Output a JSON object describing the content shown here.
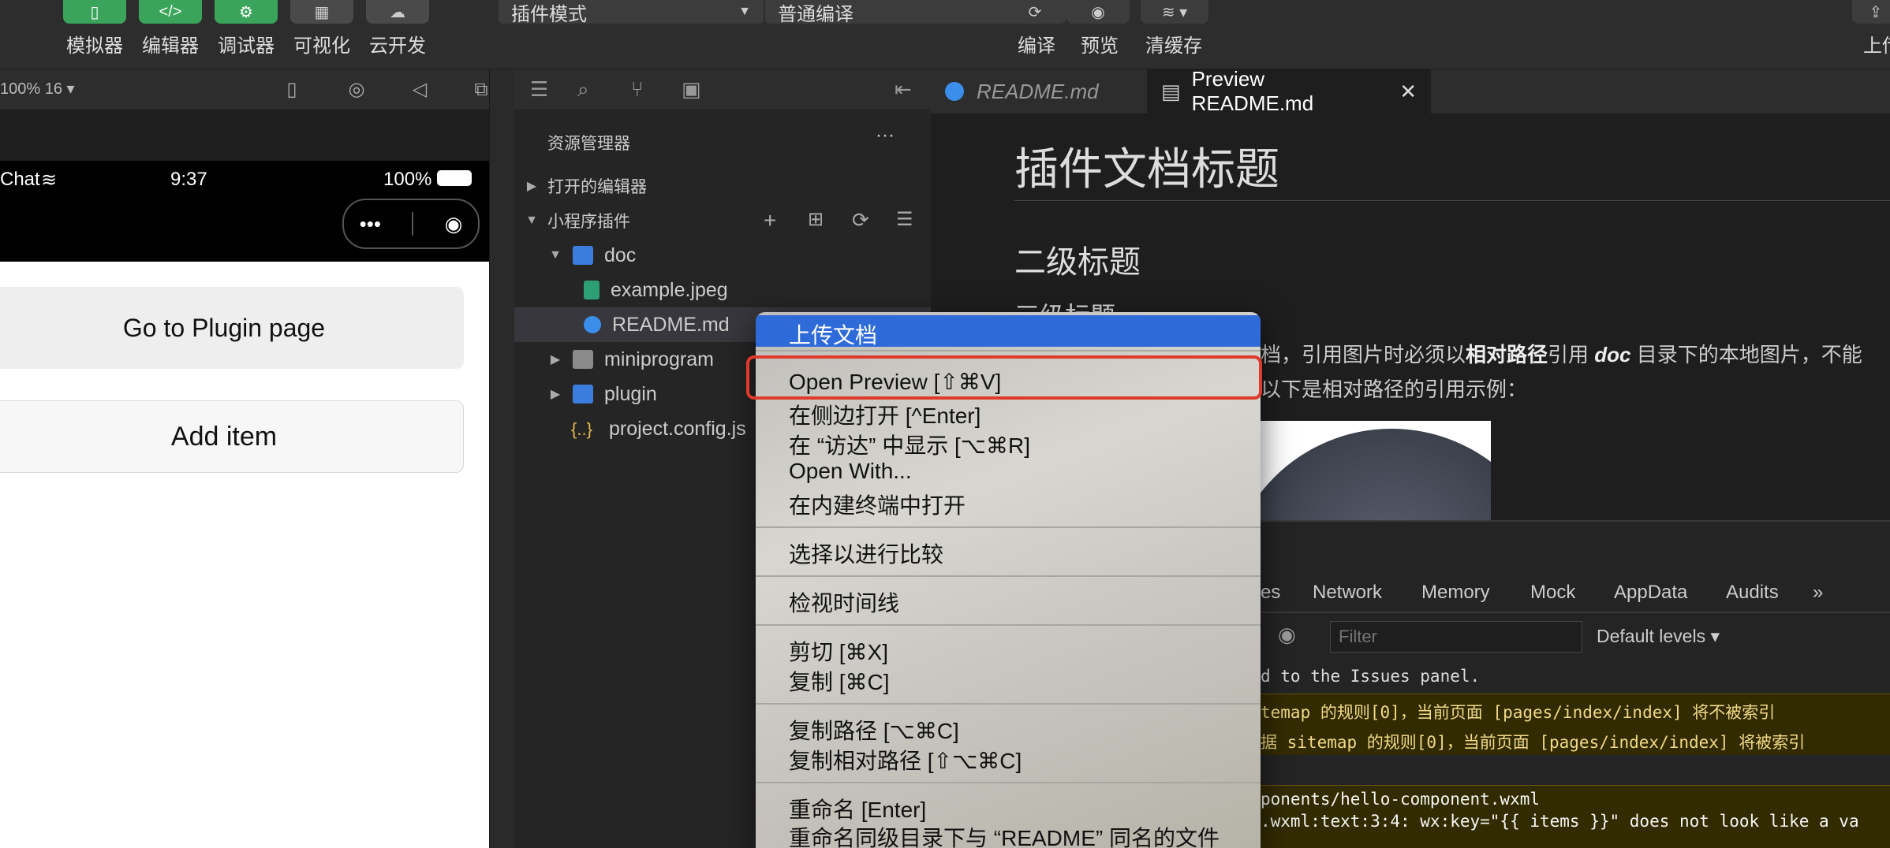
{
  "toolbar": {
    "buttons": [
      {
        "label": "模拟器",
        "icon": "phone-icon"
      },
      {
        "label": "编辑器",
        "icon": "code-icon"
      },
      {
        "label": "调试器",
        "icon": "debug-icon"
      },
      {
        "label": "可视化",
        "icon": "layout-icon"
      },
      {
        "label": "云开发",
        "icon": "cloud-icon"
      }
    ],
    "mode_select": "插件模式",
    "compile_select": "普通编译",
    "compile_label": "编译",
    "preview_label": "预览",
    "clear_cache_label": "清缓存",
    "upload_label": "上传"
  },
  "simulator": {
    "zoom": "100% 16 ▾",
    "carrier": "Chat",
    "time": "9:37",
    "battery": "100%",
    "buttons": [
      "Go to Plugin page",
      "Add item"
    ]
  },
  "explorer": {
    "title": "资源管理器",
    "more": "···",
    "open_editors": "打开的编辑器",
    "project": "小程序插件",
    "tree": [
      {
        "name": "doc"
      },
      {
        "name": "example.jpeg"
      },
      {
        "name": "README.md"
      },
      {
        "name": "miniprogram"
      },
      {
        "name": "plugin"
      },
      {
        "name": "project.config.js"
      }
    ]
  },
  "tabs": [
    {
      "label": "README.md"
    },
    {
      "label": "Preview README.md"
    }
  ],
  "markdown": {
    "h1": "插件文档标题",
    "h2": "二级标题",
    "h3": "三级标题",
    "para1_a": "档，引用图片时必须以",
    "para1_bold": "相对路径",
    "para1_b": "引用 ",
    "para1_em": "doc",
    "para1_c": " 目录下的本地图片，不能",
    "para2": "以下是相对路径的引用示例："
  },
  "devtools": {
    "tabs": [
      "es",
      "Network",
      "Memory",
      "Mock",
      "AppData",
      "Audits",
      "»"
    ],
    "filter_placeholder": "Filter",
    "levels": "Default levels ▾",
    "lines": [
      "d to the Issues panel.",
      "temap 的规则[0]，当前页面 [pages/index/index] 将不被索引",
      "据 sitemap 的规则[0]，当前页面 [pages/index/index] 将被索引",
      "ponents/hello-component.wxml",
      ".wxml:text:3:4: wx:key=\"{{ items }}\" does not look like a va"
    ]
  },
  "context_menu": {
    "items": [
      "上传文档",
      "Open Preview [⇧⌘V]",
      "在侧边打开 [^Enter]",
      "在 “访达” 中显示 [⌥⌘R]",
      "Open With...",
      "在内建终端中打开",
      "选择以进行比较",
      "检视时间线",
      "剪切 [⌘X]",
      "复制 [⌘C]",
      "复制路径 [⌥⌘C]",
      "复制相对路径 [⇧⌥⌘C]",
      "重命名 [Enter]",
      "重命名同级目录下与 “README” 同名的文件"
    ]
  },
  "colors": {
    "accent_green": "#3aa55a",
    "menu_highlight": "#2f6ad9",
    "red_box": "#e03a2c",
    "info_blue": "#3b8eea"
  }
}
